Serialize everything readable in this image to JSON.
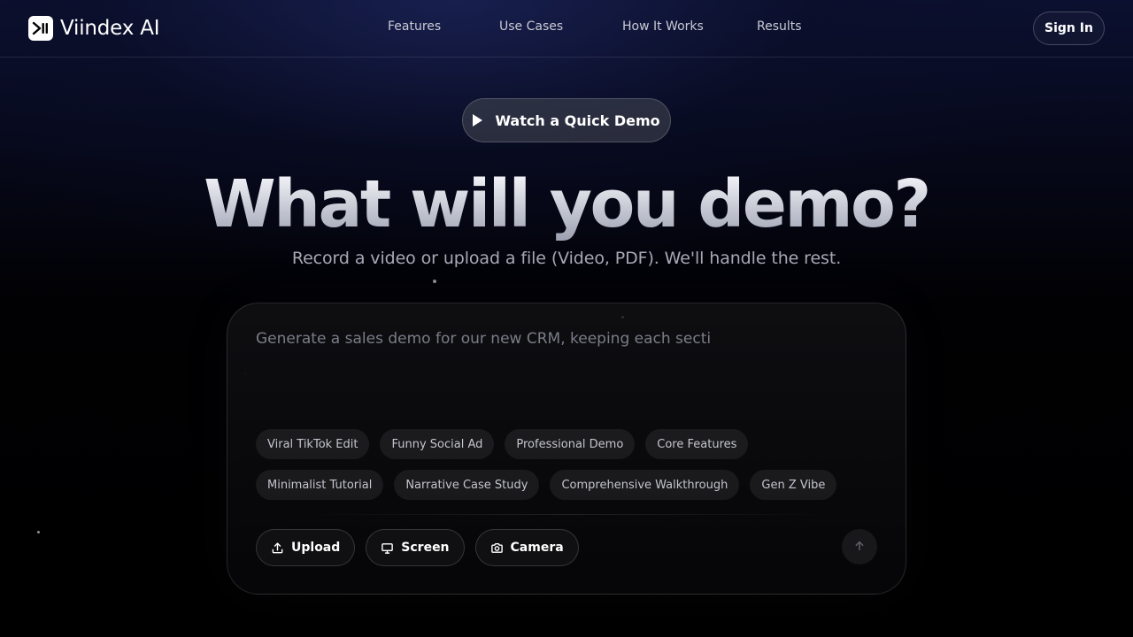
{
  "brand": {
    "name": "Viindex AI",
    "logo_icon": "play-pause-icon"
  },
  "nav": {
    "items": [
      {
        "label": "Features"
      },
      {
        "label": "Use Cases"
      },
      {
        "label": "How It Works"
      },
      {
        "label": "Results"
      }
    ],
    "sign_in_label": "Sign In"
  },
  "hero": {
    "demo_button_label": "Watch a Quick Demo",
    "demo_button_icon": "play-icon",
    "title": "What will you demo?",
    "subtitle": "Record a video or upload a file (Video, PDF). We'll handle the rest."
  },
  "composer": {
    "placeholder": "Generate a sales demo for our new CRM, keeping each secti",
    "value": "",
    "style_chips_row1": [
      {
        "label": "Viral TikTok Edit"
      },
      {
        "label": "Funny Social Ad"
      },
      {
        "label": "Professional Demo"
      },
      {
        "label": "Core Features"
      }
    ],
    "style_chips_row2": [
      {
        "label": "Minimalist Tutorial"
      },
      {
        "label": "Narrative Case Study"
      },
      {
        "label": "Comprehensive Walkthrough"
      },
      {
        "label": "Gen Z Vibe"
      }
    ],
    "actions": [
      {
        "label": "Upload",
        "icon": "upload-icon"
      },
      {
        "label": "Screen",
        "icon": "monitor-icon"
      },
      {
        "label": "Camera",
        "icon": "camera-icon"
      }
    ],
    "send_icon": "arrow-up-icon"
  },
  "colors": {
    "background": "#000000",
    "header_gradient": "#0b1030",
    "text_primary": "#ffffff",
    "text_muted": "#a6a8b4",
    "chip_bg": "#1a1a1e"
  }
}
